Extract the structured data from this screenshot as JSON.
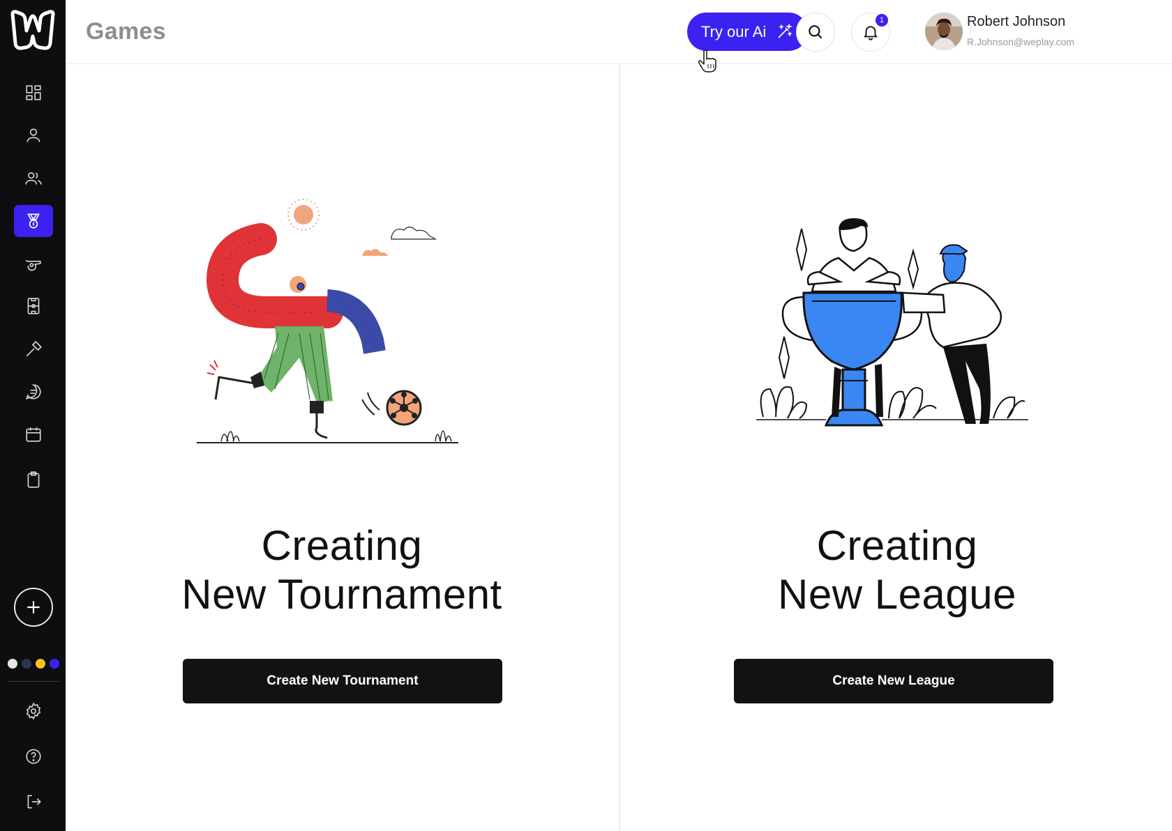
{
  "header": {
    "title": "Games",
    "ai_button_label": "Try our Ai",
    "notification_count": "1",
    "user": {
      "name": "Robert Johnson",
      "email": "R.Johnson@weplay.com"
    }
  },
  "sidebar": {
    "items": [
      {
        "icon": "dashboard-icon",
        "active": false
      },
      {
        "icon": "user-icon",
        "active": false
      },
      {
        "icon": "users-icon",
        "active": false
      },
      {
        "icon": "medal-icon",
        "active": true
      },
      {
        "icon": "whistle-icon",
        "active": false
      },
      {
        "icon": "field-icon",
        "active": false
      },
      {
        "icon": "hammer-icon",
        "active": false
      },
      {
        "icon": "chat-icon",
        "active": false
      },
      {
        "icon": "calendar-icon",
        "active": false
      },
      {
        "icon": "clipboard-icon",
        "active": false
      }
    ],
    "theme_colors": [
      "#e6e6e6",
      "#2c3552",
      "#f5c518",
      "#3b22f0"
    ],
    "bottom_items": [
      "settings-icon",
      "help-icon",
      "logout-icon"
    ]
  },
  "tournament": {
    "title_line1": "Creating",
    "title_line2": "New Tournament",
    "button_label": "Create New Tournament"
  },
  "league": {
    "title_line1": "Creating",
    "title_line2": "New League",
    "button_label": "Create New League"
  },
  "colors": {
    "accent": "#3b22f0",
    "sidebar_bg": "#0e0e10",
    "button_bg": "#121212"
  }
}
